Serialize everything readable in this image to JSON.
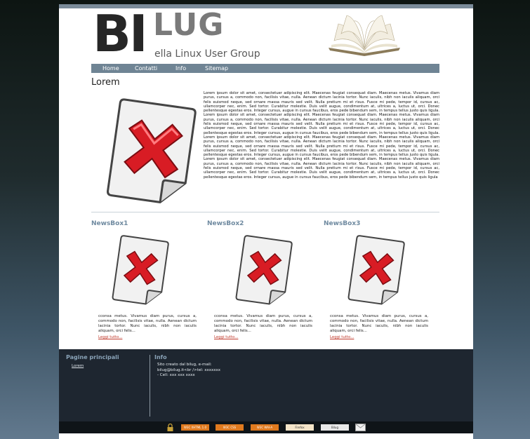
{
  "logo": {
    "bi": "BI",
    "lug": "LUG",
    "subtitle": "ella Linux User Group"
  },
  "nav": {
    "items": [
      "Home",
      "Contatti",
      "Info",
      "Sitemap"
    ]
  },
  "main": {
    "title": "Lorem",
    "body": "Lorem ipsum dolor sit amet, consectetuer adipiscing elit. Maecenas feugiat consequat diam. Maecenas metus. Vivamus diam purus, cursus a, commodo non, facilisis vitae, nulla. Aenean dictum lacinia tortor. Nunc iaculis, nibh non iaculis aliquam, orci felis euismod neque, sed ornare massa mauris sed velit. Nulla pretium mi et risus. Fusce mi pede, tempor id, cursus ac, ullamcorper nec, enim. Sed tortor. Curabitur molestie. Duis velit augue, condimentum at, ultrices a, luctus ut, orci. Donec pellentesque egestas eros. Integer cursus, augue in cursus faucibus, eros pede bibendum sem, in tempus tellus justo quis ligula. Lorem ipsum dolor sit amet, consectetuer adipiscing elit. Maecenas feugiat consequat diam. Maecenas metus. Vivamus diam purus, cursus a, commodo non, facilisis vitae, nulla. Aenean dictum lacinia tortor. Nunc iaculis, nibh non iaculis aliquam, orci felis euismod neque, sed ornare massa mauris sed velit. Nulla pretium mi et risus. Fusce mi pede, tempor id, cursus ac, ullamcorper nec, enim. Sed tortor. Curabitur molestie. Duis velit augue, condimentum at, ultrices a, luctus ut, orci. Donec pellentesque egestas eros. Integer cursus, augue in cursus faucibus, eros pede bibendum sem, in tempus tellus justo quis ligula. Lorem ipsum dolor sit amet, consectetuer adipiscing elit. Maecenas feugiat consequat diam. Maecenas metus. Vivamus diam purus, cursus a, commodo non, facilisis vitae, nulla. Aenean dictum lacinia tortor. Nunc iaculis, nibh non iaculis aliquam, orci felis euismod neque, sed ornare massa mauris sed velit. Nulla pretium mi et risus. Fusce mi pede, tempor id, cursus ac, ullamcorper nec, enim. Sed tortor. Curabitur molestie. Duis velit augue, condimentum at, ultrices a, luctus ut, orci. Donec pellentesque egestas eros. Integer cursus, augue in cursus faucibus, eros pede bibendum sem, in tempus tellus justo quis ligula. Lorem ipsum dolor sit amet, consectetuer adipiscing elit. Maecenas feugiat consequat diam. Maecenas metus. Vivamus diam purus, cursus a, commodo non, facilisis vitae, nulla. Aenean dictum lacinia tortor. Nunc iaculis, nibh non iaculis aliquam, orci felis euismod neque, sed ornare massa mauris sed velit. Nulla pretium mi et risus. Fusce mi pede, tempor id, cursus ac, ullamcorper nec, enim. Sed tortor. Curabitur molestie. Duis velit augue, condimentum at, ultrices a, luctus ut, orci. Donec pellentesque egestas eros. Integer cursus, augue in cursus faucibus, eros pede bibendum sem, in tempus tellus justo quis ligula"
  },
  "newsboxes": [
    {
      "title": "NewsBox1",
      "text": "cconsa metus. Vivamus diam purus, cursus a, commodo non, facilisis vitae, nulla. Aenean dictum lacinia tortor. Nunc iaculis, nibh non iaculis aliquam, orci felis...",
      "more": "Leggi tutto..."
    },
    {
      "title": "NewsBox2",
      "text": "cconsa metus. Vivamus diam purus, cursus a, commodo non, facilisis vitae, nulla. Aenean dictum lacinia tortor. Nunc iaculis, nibh non iaculis aliquam, orci felis...",
      "more": "Leggi tutto..."
    },
    {
      "title": "NewsBox3",
      "text": "cconsa metus. Vivamus diam purus, cursus a, commodo non, facilisis vitae, nulla. Aenean dictum lacinia tortor. Nunc iaculis, nibh non iaculis aliquam, orci felis...",
      "more": "Leggi tutto..."
    }
  ],
  "footer": {
    "left_title": "Pagine principali",
    "left_links": [
      "Lorem"
    ],
    "right_title": "Info",
    "info_lines": [
      "Sito creato dal bilug, e-mail:",
      "bilug@bilug.it<br />tel: xxxxxxx",
      " - Cell: xxx xxx xxxx"
    ]
  },
  "badges": {
    "items": [
      "W3C XHTML 1.0",
      "W3C CSS",
      "W3C WAI-A",
      "Firefox",
      "Bilug",
      ""
    ],
    "colors": {
      "w3c": "#e07a1f",
      "firefox": "#d9732a",
      "lock": "#c8a23a"
    }
  },
  "icons": {
    "book": "book-icon",
    "broken": "broken-image-icon",
    "lock": "lock-icon",
    "mail": "envelope-icon"
  }
}
